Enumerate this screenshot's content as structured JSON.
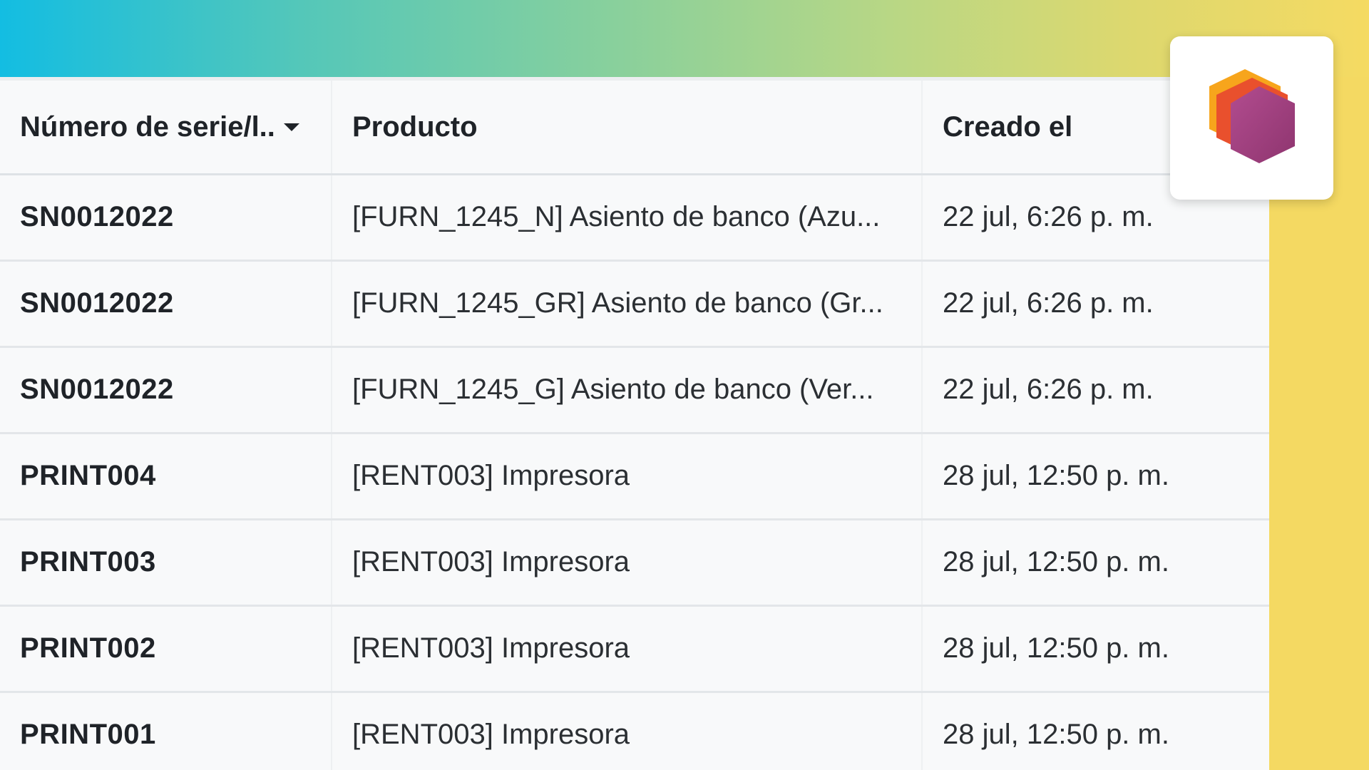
{
  "table": {
    "columns": [
      {
        "label": "Número de serie/l.."
      },
      {
        "label": "Producto"
      },
      {
        "label": "Creado el"
      }
    ],
    "sort_column": "Número de serie/l..",
    "rows": [
      {
        "serial": "SN0012022",
        "product": "[FURN_1245_N] Asiento de banco (Azu...",
        "created": "22 jul, 6:26 p. m."
      },
      {
        "serial": "SN0012022",
        "product": "[FURN_1245_GR] Asiento de banco (Gr...",
        "created": "22 jul, 6:26 p. m."
      },
      {
        "serial": "SN0012022",
        "product": "[FURN_1245_G] Asiento de banco (Ver...",
        "created": "22 jul, 6:26 p. m."
      },
      {
        "serial": "PRINT004",
        "product": "[RENT003] Impresora",
        "created": "28 jul, 12:50 p. m."
      },
      {
        "serial": "PRINT003",
        "product": "[RENT003] Impresora",
        "created": "28 jul, 12:50 p. m."
      },
      {
        "serial": "PRINT002",
        "product": "[RENT003] Impresora",
        "created": "28 jul, 12:50 p. m."
      },
      {
        "serial": "PRINT001",
        "product": "[RENT003] Impresora",
        "created": "28 jul, 12:50 p. m."
      }
    ]
  },
  "colors": {
    "gradient_start": "#13bde2",
    "gradient_end": "#f5da62",
    "table_background": "#f8f9fa",
    "logo_orange": "#f7a51c",
    "logo_red": "#e9502d",
    "logo_purple": "#a0407e"
  },
  "logo": {
    "icon": "hexagon-cube-logo-icon"
  }
}
